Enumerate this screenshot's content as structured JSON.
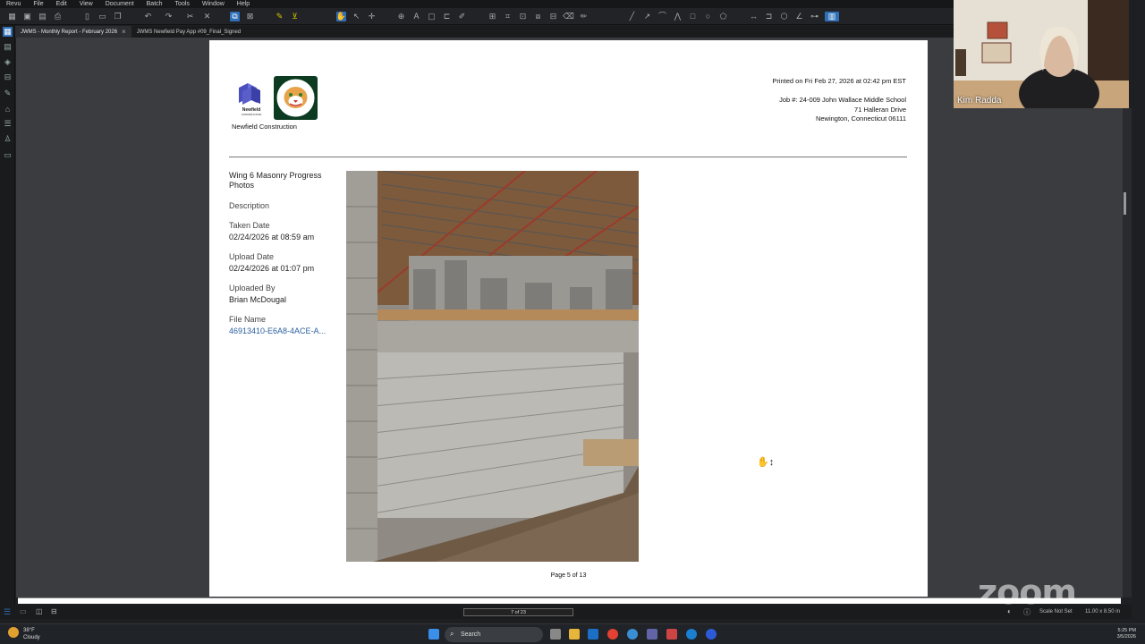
{
  "menu": [
    "Revu",
    "File",
    "Edit",
    "View",
    "Document",
    "Batch",
    "Tools",
    "Window",
    "Help"
  ],
  "tabs": [
    {
      "label": "JWMS - Monthly Report - February 2026",
      "active": true
    },
    {
      "label": "JWMS Newfield Pay App #09_Final_Signed",
      "active": false
    }
  ],
  "document": {
    "company": "Newfield Construction",
    "printed": "Printed on Fri Feb 27, 2026 at 02:42 pm EST",
    "job": "Job #: 24-009 John Wallace Middle School",
    "address1": "71 Halleran Drive",
    "address2": "Newington, Connecticut 06111",
    "photo_title": "Wing 6 Masonry Progress Photos",
    "description_label": "Description",
    "taken_label": "Taken Date",
    "taken_value": "02/24/2026 at 08:59 am",
    "upload_label": "Upload Date",
    "upload_value": "02/24/2026 at 01:07 pm",
    "uploaded_by_label": "Uploaded By",
    "uploaded_by_value": "Brian McDougal",
    "file_label": "File Name",
    "file_value": "46913410-E6A8-4ACE-A...",
    "page_footer": "Page 5 of 13"
  },
  "webcam": {
    "name": "Kim Radda"
  },
  "status": {
    "page_indicator": "7 of 23",
    "scale": "Scale Not Set",
    "dims": "11.00 x 8.50 in"
  },
  "watermark": "zoom",
  "taskbar": {
    "temp": "38°F",
    "weather": "Cloudy",
    "search": "Search",
    "time": "5:25 PM",
    "date": "3/5/2026"
  },
  "colors": {
    "accent": "#2e6fb7",
    "link": "#2a5f9e"
  }
}
